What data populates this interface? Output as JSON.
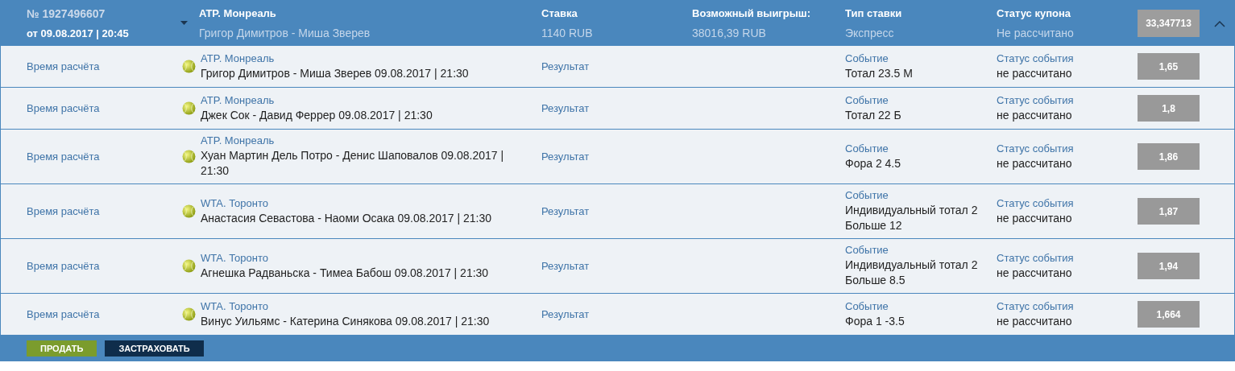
{
  "coupon": {
    "number": "№ 1927496607",
    "date": "от 09.08.2017 | 20:45",
    "tournament": "ATP. Монреаль",
    "match": "Григор Димитров - Миша Зверев",
    "stake_label": "Ставка",
    "stake": "1140 RUB",
    "win_label": "Возможный выигрыш:",
    "win": "38016,39 RUB",
    "type_label": "Тип ставки",
    "type": "Экспресс",
    "status_label": "Статус купона",
    "status": "Не рассчитано",
    "odds": "33,347713",
    "expanded": true
  },
  "events": [
    {
      "time_label": "Время расчёта",
      "tournament": "ATP. Монреаль",
      "match": "Григор Димитров - Миша Зверев 09.08.2017 | 21:30",
      "result_label": "Результат",
      "event_label": "Событие",
      "event": "Тотал 23.5 М",
      "status_label": "Статус события",
      "status": "не рассчитано",
      "odds": "1,65"
    },
    {
      "time_label": "Время расчёта",
      "tournament": "ATP. Монреаль",
      "match": "Джек Сок - Давид Феррер 09.08.2017 | 21:30",
      "result_label": "Результат",
      "event_label": "Событие",
      "event": "Тотал 22 Б",
      "status_label": "Статус события",
      "status": "не рассчитано",
      "odds": "1,8"
    },
    {
      "time_label": "Время расчёта",
      "tournament": "ATP. Монреаль",
      "match": "Хуан Мартин Дель Потро - Денис Шаповалов 09.08.2017 | 21:30",
      "result_label": "Результат",
      "event_label": "Событие",
      "event": "Фора 2 4.5",
      "status_label": "Статус события",
      "status": "не рассчитано",
      "odds": "1,86"
    },
    {
      "time_label": "Время расчёта",
      "tournament": "WTA. Торонто",
      "match": "Анастасия Севастова - Наоми Осака 09.08.2017 | 21:30",
      "result_label": "Результат",
      "event_label": "Событие",
      "event": "Индивидуальный тотал 2 Больше 12",
      "status_label": "Статус события",
      "status": "не рассчитано",
      "odds": "1,87"
    },
    {
      "time_label": "Время расчёта",
      "tournament": "WTA. Торонто",
      "match": "Агнешка Радваньска - Тимеа Бабош 09.08.2017 | 21:30",
      "result_label": "Результат",
      "event_label": "Событие",
      "event": "Индивидуальный тотал 2 Больше 8.5",
      "status_label": "Статус события",
      "status": "не рассчитано",
      "odds": "1,94"
    },
    {
      "time_label": "Время расчёта",
      "tournament": "WTA. Торонто",
      "match": "Винус Уильямс - Катерина Синякова 09.08.2017 | 21:30",
      "result_label": "Результат",
      "event_label": "Событие",
      "event": "Фора 1 -3.5",
      "status_label": "Статус события",
      "status": "не рассчитано",
      "odds": "1,664"
    }
  ],
  "buttons": [
    {
      "label": "ПРОДАТЬ",
      "kind": "sell"
    },
    {
      "label": "ЗАСТРАХОВАТЬ",
      "kind": "insure"
    }
  ]
}
